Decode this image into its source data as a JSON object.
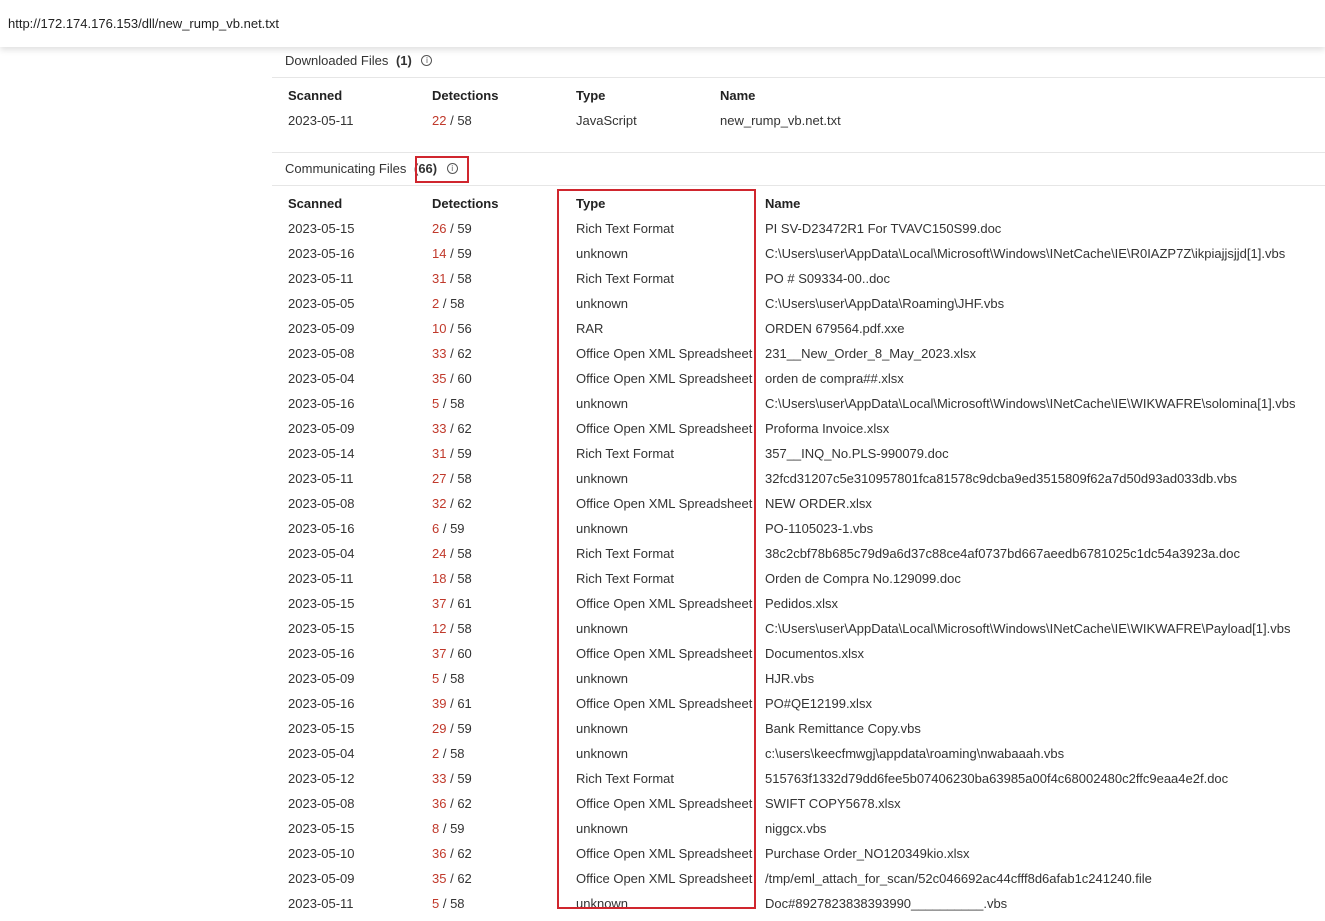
{
  "url": "http://172.174.176.153/dll/new_rump_vb.net.txt",
  "downloaded": {
    "title": "Downloaded Files",
    "count": "(1)",
    "headers": {
      "scanned": "Scanned",
      "detections": "Detections",
      "type": "Type",
      "name": "Name"
    },
    "rows": [
      {
        "scanned": "2023-05-11",
        "det": "22",
        "total": "58",
        "type": "JavaScript",
        "name": "new_rump_vb.net.txt"
      }
    ]
  },
  "communicating": {
    "title": "Communicating Files",
    "count": "(66)",
    "headers": {
      "scanned": "Scanned",
      "detections": "Detections",
      "type": "Type",
      "name": "Name"
    },
    "rows": [
      {
        "scanned": "2023-05-15",
        "det": "26",
        "total": "59",
        "type": "Rich Text Format",
        "name": "PI SV-D23472R1 For TVAVC150S99.doc"
      },
      {
        "scanned": "2023-05-16",
        "det": "14",
        "total": "59",
        "type": "unknown",
        "name": "C:\\Users\\user\\AppData\\Local\\Microsoft\\Windows\\INetCache\\IE\\R0IAZP7Z\\ikpiajjsjjd[1].vbs"
      },
      {
        "scanned": "2023-05-11",
        "det": "31",
        "total": "58",
        "type": "Rich Text Format",
        "name": "PO # S09334-00..doc"
      },
      {
        "scanned": "2023-05-05",
        "det": "2",
        "total": "58",
        "type": "unknown",
        "name": "C:\\Users\\user\\AppData\\Roaming\\JHF.vbs"
      },
      {
        "scanned": "2023-05-09",
        "det": "10",
        "total": "56",
        "type": "RAR",
        "name": "ORDEN 679564.pdf.xxe"
      },
      {
        "scanned": "2023-05-08",
        "det": "33",
        "total": "62",
        "type": "Office Open XML Spreadsheet",
        "name": "231__New_Order_8_May_2023.xlsx"
      },
      {
        "scanned": "2023-05-04",
        "det": "35",
        "total": "60",
        "type": "Office Open XML Spreadsheet",
        "name": "orden de compra##.xlsx"
      },
      {
        "scanned": "2023-05-16",
        "det": "5",
        "total": "58",
        "type": "unknown",
        "name": "C:\\Users\\user\\AppData\\Local\\Microsoft\\Windows\\INetCache\\IE\\WIKWAFRE\\solomina[1].vbs"
      },
      {
        "scanned": "2023-05-09",
        "det": "33",
        "total": "62",
        "type": "Office Open XML Spreadsheet",
        "name": "Proforma Invoice.xlsx"
      },
      {
        "scanned": "2023-05-14",
        "det": "31",
        "total": "59",
        "type": "Rich Text Format",
        "name": "357__INQ_No.PLS-990079.doc"
      },
      {
        "scanned": "2023-05-11",
        "det": "27",
        "total": "58",
        "type": "unknown",
        "name": "32fcd31207c5e310957801fca81578c9dcba9ed3515809f62a7d50d93ad033db.vbs"
      },
      {
        "scanned": "2023-05-08",
        "det": "32",
        "total": "62",
        "type": "Office Open XML Spreadsheet",
        "name": "NEW ORDER.xlsx"
      },
      {
        "scanned": "2023-05-16",
        "det": "6",
        "total": "59",
        "type": "unknown",
        "name": "PO-1105023-1.vbs"
      },
      {
        "scanned": "2023-05-04",
        "det": "24",
        "total": "58",
        "type": "Rich Text Format",
        "name": "38c2cbf78b685c79d9a6d37c88ce4af0737bd667aeedb6781025c1dc54a3923a.doc"
      },
      {
        "scanned": "2023-05-11",
        "det": "18",
        "total": "58",
        "type": "Rich Text Format",
        "name": "Orden de Compra No.129099.doc"
      },
      {
        "scanned": "2023-05-15",
        "det": "37",
        "total": "61",
        "type": "Office Open XML Spreadsheet",
        "name": "Pedidos.xlsx"
      },
      {
        "scanned": "2023-05-15",
        "det": "12",
        "total": "58",
        "type": "unknown",
        "name": "C:\\Users\\user\\AppData\\Local\\Microsoft\\Windows\\INetCache\\IE\\WIKWAFRE\\Payload[1].vbs"
      },
      {
        "scanned": "2023-05-16",
        "det": "37",
        "total": "60",
        "type": "Office Open XML Spreadsheet",
        "name": "Documentos.xlsx"
      },
      {
        "scanned": "2023-05-09",
        "det": "5",
        "total": "58",
        "type": "unknown",
        "name": "HJR.vbs"
      },
      {
        "scanned": "2023-05-16",
        "det": "39",
        "total": "61",
        "type": "Office Open XML Spreadsheet",
        "name": "PO#QE12199.xlsx"
      },
      {
        "scanned": "2023-05-15",
        "det": "29",
        "total": "59",
        "type": "unknown",
        "name": "Bank Remittance Copy.vbs"
      },
      {
        "scanned": "2023-05-04",
        "det": "2",
        "total": "58",
        "type": "unknown",
        "name": "c:\\users\\keecfmwgj\\appdata\\roaming\\nwabaaah.vbs"
      },
      {
        "scanned": "2023-05-12",
        "det": "33",
        "total": "59",
        "type": "Rich Text Format",
        "name": "515763f1332d79dd6fee5b07406230ba63985a00f4c68002480c2ffc9eaa4e2f.doc"
      },
      {
        "scanned": "2023-05-08",
        "det": "36",
        "total": "62",
        "type": "Office Open XML Spreadsheet",
        "name": "SWIFT COPY5678.xlsx"
      },
      {
        "scanned": "2023-05-15",
        "det": "8",
        "total": "59",
        "type": "unknown",
        "name": "niggcx.vbs"
      },
      {
        "scanned": "2023-05-10",
        "det": "36",
        "total": "62",
        "type": "Office Open XML Spreadsheet",
        "name": "Purchase Order_NO120349kio.xlsx"
      },
      {
        "scanned": "2023-05-09",
        "det": "35",
        "total": "62",
        "type": "Office Open XML Spreadsheet",
        "name": "/tmp/eml_attach_for_scan/52c046692ac44cfff8d6afab1c241240.file"
      },
      {
        "scanned": "2023-05-11",
        "det": "5",
        "total": "58",
        "type": "unknown",
        "name": "Doc#8927823838393990__________.vbs"
      }
    ]
  },
  "colors": {
    "detection": "#c0392b",
    "highlight": "#d0262e"
  },
  "icons": {
    "info": "info-icon"
  }
}
